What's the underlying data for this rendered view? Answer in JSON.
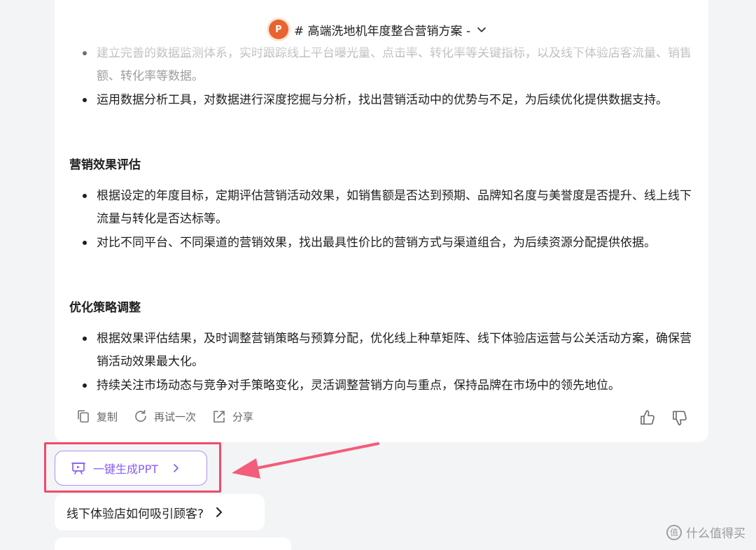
{
  "header": {
    "doc_title": "# 高端洗地机年度整合营销方案 -",
    "ppt_icon_letter": "P"
  },
  "content": {
    "bullets_top": [
      "建立完善的数据监测体系，实时跟踪线上平台曝光量、点击率、转化率等关键指标，以及线下体验店客流量、销售额、转化率等数据。",
      "运用数据分析工具，对数据进行深度挖掘与分析，找出营销活动中的优势与不足，为后续优化提供数据支持。"
    ],
    "section_eval": {
      "heading": "营销效果评估",
      "bullets": [
        "根据设定的年度目标，定期评估营销活动效果，如销售额是否达到预期、品牌知名度与美誉度是否提升、线上线下流量与转化是否达标等。",
        "对比不同平台、不同渠道的营销效果，找出最具性价比的营销方式与渠道组合，为后续资源分配提供依据。"
      ]
    },
    "section_opt": {
      "heading": "优化策略调整",
      "bullets": [
        "根据效果评估结果，及时调整营销策略与预算分配，优化线上种草矩阵、线下体验店运营与公关活动方案，确保营销活动效果最大化。",
        "持续关注市场动态与竞争对手策略变化，灵活调整营销方向与重点，保持品牌在市场中的领先地位。"
      ]
    }
  },
  "actions": {
    "copy": "复制",
    "retry": "再试一次",
    "share": "分享"
  },
  "generate_ppt": {
    "label": "一键生成PPT"
  },
  "suggestions": [
    "线下体验店如何吸引顾客?"
  ],
  "watermark": {
    "text": "什么值得买",
    "logo_char": "值"
  },
  "colors": {
    "accent_purple": "#8a5cf6",
    "highlight_red": "#ef4a6c",
    "ppt_orange": "#e9632e"
  }
}
